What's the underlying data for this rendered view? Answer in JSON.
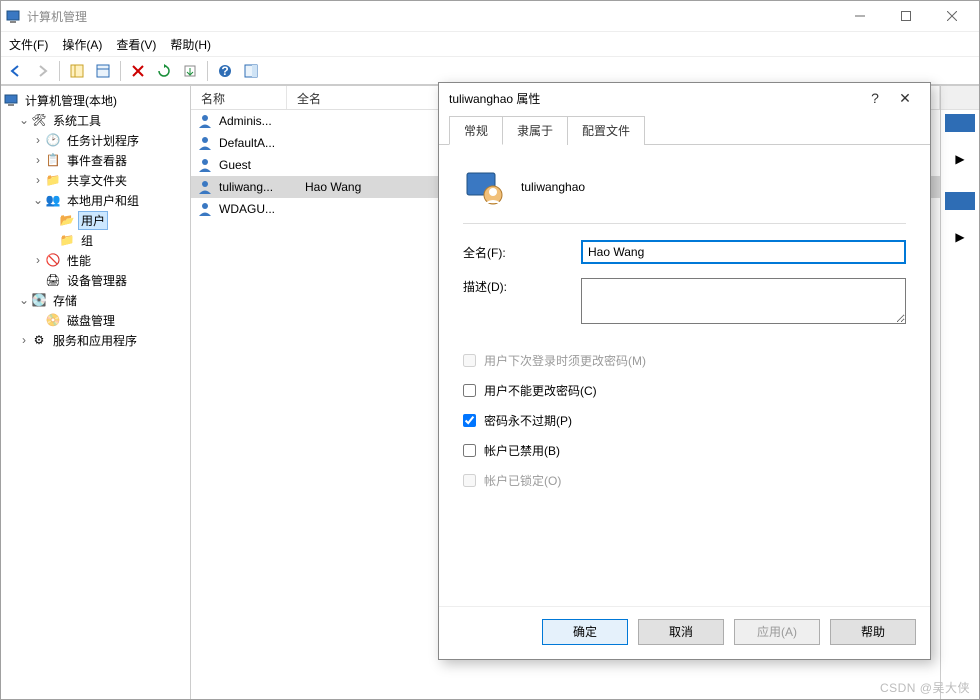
{
  "window": {
    "title": "计算机管理",
    "menus": [
      "文件(F)",
      "操作(A)",
      "查看(V)",
      "帮助(H)"
    ]
  },
  "tree": {
    "root": "计算机管理(本地)",
    "sys_tools": "系统工具",
    "task_sched": "任务计划程序",
    "event_viewer": "事件查看器",
    "shared": "共享文件夹",
    "local_users": "本地用户和组",
    "users_folder": "用户",
    "groups_folder": "组",
    "perf": "性能",
    "devmgr": "设备管理器",
    "storage": "存储",
    "diskmgmt": "磁盘管理",
    "svc_apps": "服务和应用程序"
  },
  "list": {
    "col_name": "名称",
    "col_fullname": "全名",
    "rows": [
      {
        "name": "Adminis...",
        "full": ""
      },
      {
        "name": "DefaultA...",
        "full": ""
      },
      {
        "name": "Guest",
        "full": ""
      },
      {
        "name": "tuliwang...",
        "full": "Hao Wang",
        "selected": true
      },
      {
        "name": "WDAGU...",
        "full": ""
      }
    ]
  },
  "dialog": {
    "title": "tuliwanghao 属性",
    "tabs": {
      "general": "常规",
      "memberof": "隶属于",
      "profile": "配置文件"
    },
    "username": "tuliwanghao",
    "fullname_label": "全名(F):",
    "fullname_value": "Hao Wang",
    "desc_label": "描述(D):",
    "desc_value": "",
    "chk_must_change": "用户下次登录时须更改密码(M)",
    "chk_cannot_change": "用户不能更改密码(C)",
    "chk_never_expire": "密码永不过期(P)",
    "chk_disabled": "帐户已禁用(B)",
    "chk_locked": "帐户已锁定(O)",
    "buttons": {
      "ok": "确定",
      "cancel": "取消",
      "apply": "应用(A)",
      "help": "帮助"
    }
  },
  "watermark": "CSDN @吴大侠"
}
